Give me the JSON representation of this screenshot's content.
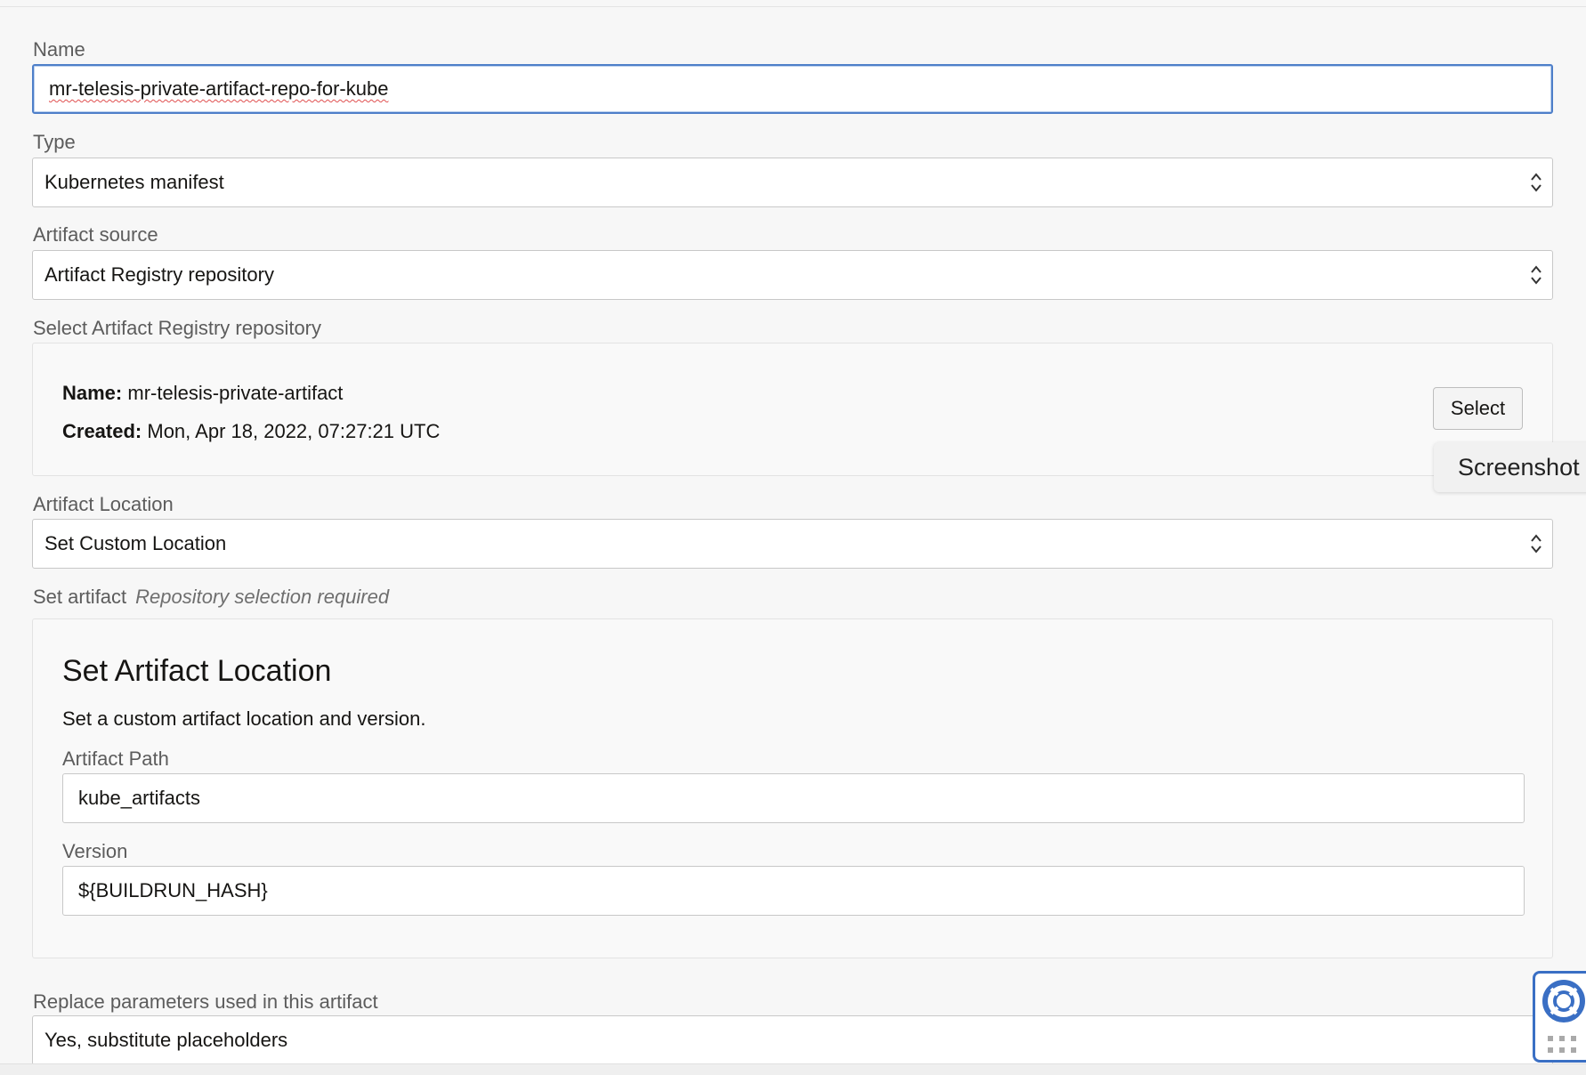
{
  "form": {
    "name": {
      "label": "Name",
      "value": "mr-telesis-private-artifact-repo-for-kube"
    },
    "type": {
      "label": "Type",
      "value": "Kubernetes manifest"
    },
    "artifact_source": {
      "label": "Artifact source",
      "value": "Artifact Registry repository"
    },
    "select_repository": {
      "label": "Select Artifact Registry repository",
      "name_key": "Name:",
      "name_value": "mr-telesis-private-artifact",
      "created_key": "Created:",
      "created_value": "Mon, Apr 18, 2022, 07:27:21 UTC",
      "select_button": "Select"
    },
    "artifact_location": {
      "label": "Artifact Location",
      "value": "Set Custom Location"
    },
    "set_artifact": {
      "label": "Set artifact",
      "hint": "Repository selection required",
      "panel_title": "Set Artifact Location",
      "panel_description": "Set a custom artifact location and version.",
      "path_label": "Artifact Path",
      "path_value": "kube_artifacts",
      "version_label": "Version",
      "version_value": "${BUILDRUN_HASH}"
    },
    "replace_parameters": {
      "label": "Replace parameters used in this artifact",
      "value": "Yes, substitute placeholders"
    }
  },
  "tooltip": {
    "text": "Screenshot"
  },
  "icons": {
    "select_chevron": "chevron-up-down-icon",
    "help": "lifebuoy-icon",
    "grid": "grid-dots-icon"
  },
  "colors": {
    "focus_border": "#4e7fc9",
    "help_accent": "#3a6fc4",
    "spellcheck": "#e05050"
  }
}
